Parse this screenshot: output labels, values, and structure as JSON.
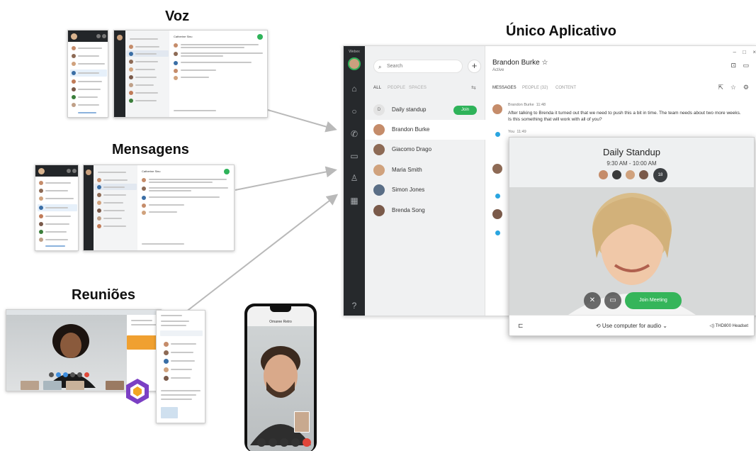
{
  "titles": {
    "voz": "Voz",
    "mensagens": "Mensagens",
    "reunioes": "Reuniões",
    "unico": "Único Aplicativo"
  },
  "thumbnails": {
    "voz_contact": "Catherine Sinu",
    "mensagens_contact": "Catherine Sinu"
  },
  "app": {
    "brand": "Webex",
    "search_placeholder": "Search",
    "filters": [
      "ALL",
      "PEOPLE",
      "SPACES"
    ],
    "spaces": [
      {
        "name": "Daily standup",
        "badge": "D"
      },
      {
        "name": "Brandon Burke"
      },
      {
        "name": "Giacomo Drago"
      },
      {
        "name": "Maria Smith"
      },
      {
        "name": "Simon Jones"
      },
      {
        "name": "Brenda Song"
      }
    ],
    "join_label": "Join",
    "header": {
      "name": "Brandon Burke",
      "status": "Active"
    },
    "tabs": [
      "MESSAGES",
      "PEOPLE (32)",
      "CONTENT"
    ],
    "messages": [
      {
        "author": "Brandon Burke",
        "time": "11:48",
        "text": "After talking to Brenda it turned out that we need to push this a bit in time. The team needs about two more weeks. Is this something that will work with all of you?"
      },
      {
        "author": "You",
        "time": "11:49",
        "text": ""
      }
    ]
  },
  "meeting": {
    "title": "Daily Standup",
    "time": "9:30 AM - 10:00 AM",
    "participant_count": "18",
    "join_label": "Join Meeting",
    "audio_label": "Use computer for audio",
    "headset_label": "THD800 Headset"
  },
  "phone": {
    "caller": "Omaree Retro"
  },
  "colors": {
    "accent_green": "#2fb35a",
    "rail_dark": "#26292c",
    "arrow_gray": "#b9b9b9"
  }
}
